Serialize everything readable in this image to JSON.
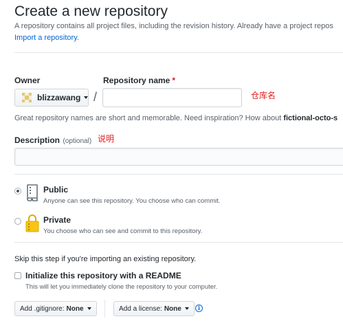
{
  "header": {
    "title": "Create a new repository",
    "subtitle": "A repository contains all project files, including the revision history. Already have a project repos",
    "import_link": "Import a repository."
  },
  "owner": {
    "label": "Owner",
    "username": "blizzawang"
  },
  "repo_name": {
    "label": "Repository name",
    "required_mark": "*",
    "value": "",
    "annotation": "仓库名",
    "slash": "/"
  },
  "hint": {
    "text": "Great repository names are short and memorable. Need inspiration? How about ",
    "suggestion": "fictional-octo-s"
  },
  "description": {
    "label": "Description",
    "optional": "(optional)",
    "annotation": "说明",
    "value": ""
  },
  "visibility": {
    "selected": "public",
    "public": {
      "title": "Public",
      "desc": "Anyone can see this repository. You choose who can commit."
    },
    "private": {
      "title": "Private",
      "desc": "You choose who can see and commit to this repository."
    }
  },
  "init": {
    "skip_text": "Skip this step if you're importing an existing repository.",
    "readme_title": "Initialize this repository with a README",
    "readme_desc": "This will let you immediately clone the repository to your computer.",
    "readme_checked": false
  },
  "buttons": {
    "gitignore_label": "Add .gitignore:",
    "gitignore_value": "None",
    "license_label": "Add a license:",
    "license_value": "None",
    "info": "i"
  },
  "colors": {
    "link": "#0366d6",
    "annotation": "#e02020",
    "required": "#cb2431"
  }
}
